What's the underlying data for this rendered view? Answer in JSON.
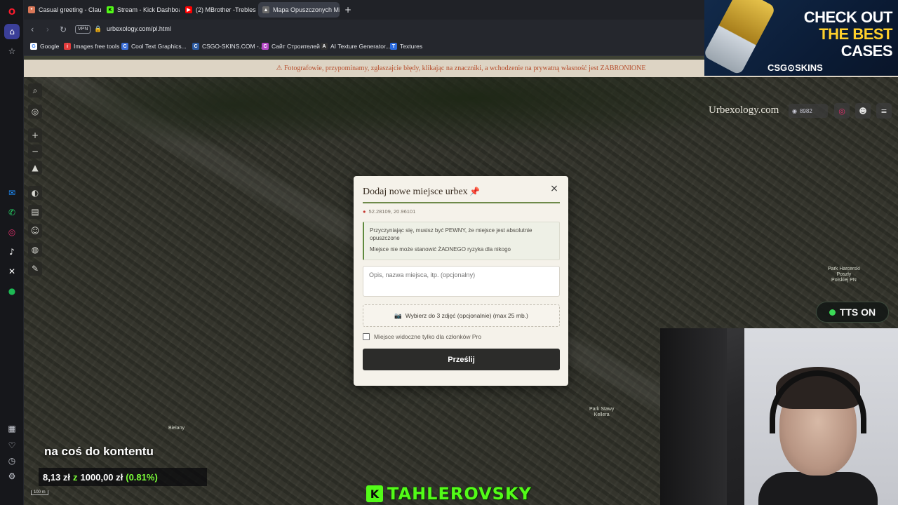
{
  "browser": {
    "tabs": [
      {
        "label": "Casual greeting - Claude",
        "color": "#d97757",
        "glyph": "*"
      },
      {
        "label": "Stream - Kick Dashboard",
        "color": "#53fc18",
        "glyph": "K"
      },
      {
        "label": "(2) MBrother -Trebles",
        "color": "#ff0000",
        "glyph": "▶"
      },
      {
        "label": "Mapa Opuszczonych Mie",
        "color": "#777777",
        "glyph": "▲"
      }
    ],
    "new_tab_icon": "plus-icon",
    "vpn_label": "VPN",
    "url": "urbexology.com/pl.html",
    "bookmarks": [
      {
        "label": "Google",
        "color": "#ffffff",
        "glyph": "G"
      },
      {
        "label": "Images free tools",
        "color": "#e23b3b",
        "glyph": "i"
      },
      {
        "label": "Cool Text Graphics...",
        "color": "#3c6fd8",
        "glyph": "C"
      },
      {
        "label": "CSGO-SKINS.COM -...",
        "color": "#2c5aa0",
        "glyph": "C"
      },
      {
        "label": "Сайт Строителей",
        "color": "#b548c6",
        "glyph": "С"
      },
      {
        "label": "AI Texture Generator...",
        "color": "#333333",
        "glyph": "A"
      },
      {
        "label": "Textures",
        "color": "#2d6cdf",
        "glyph": "T"
      }
    ]
  },
  "page": {
    "notice": "⚠ Fotografowie, przypominamy, zgłaszajcie błędy, klikając na znaczniki, a wchodzenie na prywatną własność jest ZABRONIONE",
    "brand": "Urbexology.com",
    "discord_count": "8982",
    "map_labels": {
      "bielany": "Bielany",
      "park_harcerski": "Park Harcerski\nPoszły\nPolskiej PN",
      "park_kaskada": "Park Stawy\nKellera",
      "scale": "100 m"
    }
  },
  "modal": {
    "title": "Dodaj nowe miejsce urbex",
    "close_label": "×",
    "coords": "52.28109, 20.96101",
    "warning_line1": "Przyczyniając się, musisz być PEWNY, że miejsce jest absolutnie opuszczone",
    "warning_line2": "Miejsce nie może stanowić ŻADNEGO ryzyka dla nikogo",
    "description_placeholder": "Opis, nazwa miejsca, itp. (opcjonalny)",
    "photo_label": "Wybierz do 3 zdjęć (opcjonalnie) (max 25 mb.)",
    "pro_label": "Miejsce widoczne tylko dla członków Pro",
    "submit_label": "Prześlij"
  },
  "overlay": {
    "ad_line1": "CHECK OUT",
    "ad_line2": "THE BEST",
    "ad_line3": "CASES",
    "ad_brand": "CSG⊙SKINS",
    "tts": "TTS ON",
    "subtitle": "na coś do kontentu",
    "donation_current": "8,13 zł",
    "donation_sep": "z",
    "donation_goal": "1000,00 zł",
    "donation_pct": "(0.81%)",
    "streamer": "TAHLEROVSKY",
    "kick_glyph": "K"
  }
}
